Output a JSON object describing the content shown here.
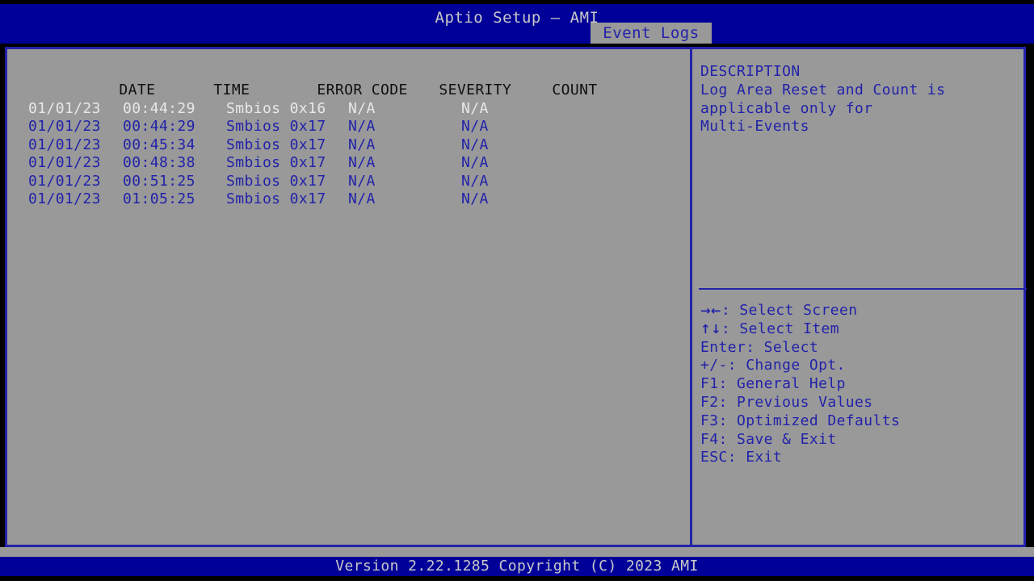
{
  "window": {
    "title": "Aptio Setup – AMI",
    "header_bg": "#000099",
    "body_bg": "#999999",
    "border_color": "#2222aa",
    "accent_text": "#2222aa"
  },
  "tabs": [
    {
      "label": "Event Logs",
      "active": true
    }
  ],
  "table": {
    "columns": [
      "DATE",
      "TIME",
      "ERROR CODE",
      "SEVERITY",
      "COUNT"
    ],
    "rows": [
      {
        "date": "01/01/23",
        "time": "00:44:29",
        "error_code": "Smbios 0x16",
        "severity": "N/A",
        "count": "N/A",
        "selected": true
      },
      {
        "date": "01/01/23",
        "time": "00:44:29",
        "error_code": "Smbios 0x17",
        "severity": "N/A",
        "count": "N/A",
        "selected": false
      },
      {
        "date": "01/01/23",
        "time": "00:45:34",
        "error_code": "Smbios 0x17",
        "severity": "N/A",
        "count": "N/A",
        "selected": false
      },
      {
        "date": "01/01/23",
        "time": "00:48:38",
        "error_code": "Smbios 0x17",
        "severity": "N/A",
        "count": "N/A",
        "selected": false
      },
      {
        "date": "01/01/23",
        "time": "00:51:25",
        "error_code": "Smbios 0x17",
        "severity": "N/A",
        "count": "N/A",
        "selected": false
      },
      {
        "date": "01/01/23",
        "time": "01:05:25",
        "error_code": "Smbios 0x17",
        "severity": "N/A",
        "count": "N/A",
        "selected": false
      }
    ]
  },
  "description": {
    "heading": "DESCRIPTION",
    "lines": [
      "Log Area Reset and Count is",
      "applicable only for",
      "Multi-Events"
    ]
  },
  "help": {
    "items": [
      {
        "keys": "→←",
        "glyph": true,
        "text": ": Select Screen"
      },
      {
        "keys": "↑↓",
        "glyph": true,
        "text": ": Select Item"
      },
      {
        "keys": "Enter",
        "glyph": false,
        "text": ": Select"
      },
      {
        "keys": "+/-",
        "glyph": false,
        "text": ": Change Opt."
      },
      {
        "keys": "F1",
        "glyph": false,
        "text": ": General Help"
      },
      {
        "keys": "F2",
        "glyph": false,
        "text": ": Previous Values"
      },
      {
        "keys": "F3",
        "glyph": false,
        "text": ": Optimized Defaults"
      },
      {
        "keys": "F4",
        "glyph": false,
        "text": ": Save & Exit"
      },
      {
        "keys": "ESC",
        "glyph": false,
        "text": ": Exit"
      }
    ]
  },
  "footer": {
    "text": "Version 2.22.1285 Copyright (C) 2023 AMI"
  }
}
